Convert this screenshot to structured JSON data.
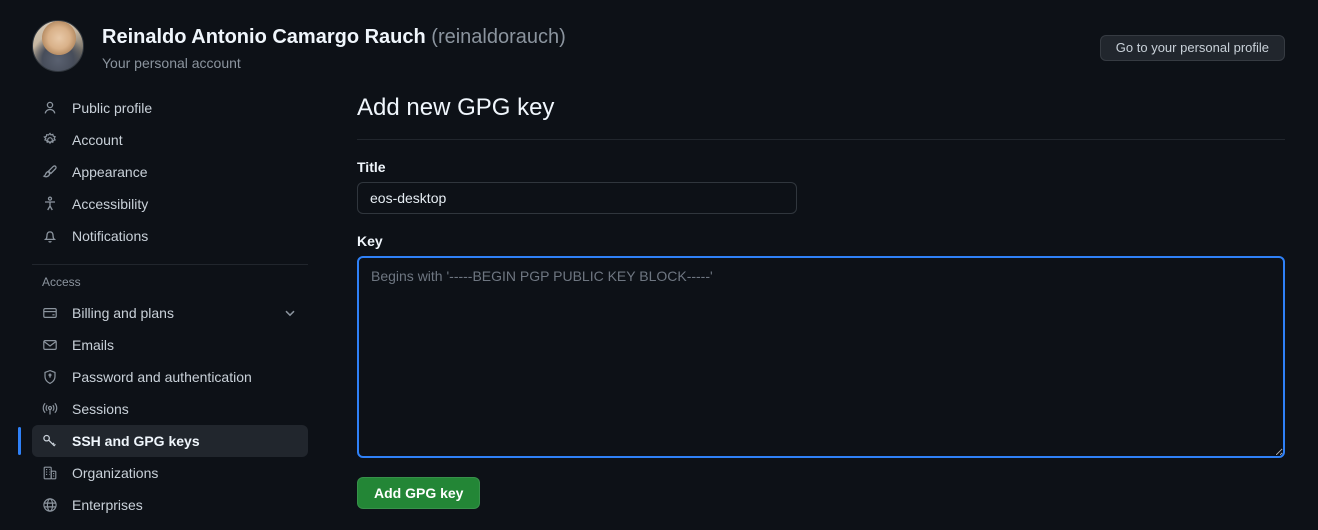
{
  "header": {
    "fullname": "Reinaldo Antonio Camargo Rauch",
    "handle": "(reinaldorauch)",
    "subtitle": "Your personal account",
    "profile_button": "Go to your personal profile"
  },
  "sidebar": {
    "primary": [
      {
        "label": "Public profile",
        "icon": "person-icon"
      },
      {
        "label": "Account",
        "icon": "gear-icon"
      },
      {
        "label": "Appearance",
        "icon": "paintbrush-icon"
      },
      {
        "label": "Accessibility",
        "icon": "accessibility-icon"
      },
      {
        "label": "Notifications",
        "icon": "bell-icon"
      }
    ],
    "section_label": "Access",
    "access": [
      {
        "label": "Billing and plans",
        "icon": "credit-card-icon"
      },
      {
        "label": "Emails",
        "icon": "envelope-icon"
      },
      {
        "label": "Password and authentication",
        "icon": "shield-lock-icon"
      },
      {
        "label": "Sessions",
        "icon": "broadcast-icon"
      },
      {
        "label": "SSH and GPG keys",
        "icon": "key-icon"
      },
      {
        "label": "Organizations",
        "icon": "organization-icon"
      },
      {
        "label": "Enterprises",
        "icon": "globe-icon"
      }
    ]
  },
  "main": {
    "page_title": "Add new GPG key",
    "title_label": "Title",
    "title_value": "eos-desktop",
    "key_label": "Key",
    "key_placeholder": "Begins with '-----BEGIN PGP PUBLIC KEY BLOCK-----'",
    "submit_label": "Add GPG key"
  },
  "colors": {
    "background": "#0d1117",
    "accent_blue": "#2f81f7",
    "success_green": "#238636",
    "muted_text": "#8b949e",
    "border": "#30363d"
  }
}
